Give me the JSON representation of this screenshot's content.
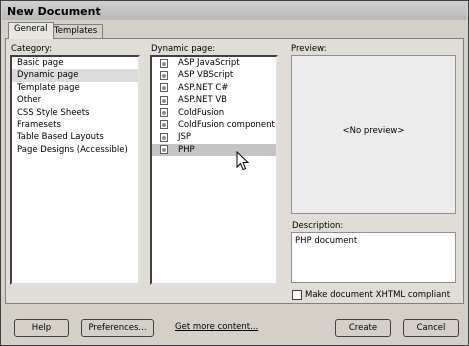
{
  "window": {
    "title": "New Document"
  },
  "tabs": [
    {
      "label": "General",
      "active": true
    },
    {
      "label": "Templates",
      "active": false
    }
  ],
  "category": {
    "label": "Category:",
    "items": [
      {
        "label": "Basic page"
      },
      {
        "label": "Dynamic page",
        "selected": true
      },
      {
        "label": "Template page"
      },
      {
        "label": "Other"
      },
      {
        "label": "CSS Style Sheets"
      },
      {
        "label": "Framesets"
      },
      {
        "label": "Table Based Layouts"
      },
      {
        "label": "Page Designs (Accessible)"
      }
    ]
  },
  "dynamic": {
    "label": "Dynamic page:",
    "items": [
      {
        "label": "ASP JavaScript"
      },
      {
        "label": "ASP VBScript"
      },
      {
        "label": "ASP.NET C#"
      },
      {
        "label": "ASP.NET VB"
      },
      {
        "label": "ColdFusion"
      },
      {
        "label": "ColdFusion component"
      },
      {
        "label": "JSP"
      },
      {
        "label": "PHP",
        "selected": true
      }
    ],
    "icon": "dynamic-document-icon"
  },
  "preview": {
    "label": "Preview:",
    "placeholder": "<No preview>"
  },
  "description": {
    "label": "Description:",
    "text": "PHP document"
  },
  "xhtml": {
    "label": "Make document XHTML compliant",
    "checked": false
  },
  "buttons": {
    "help": "Help",
    "preferences": "Preferences...",
    "more": "Get more content...",
    "create": "Create",
    "cancel": "Cancel"
  }
}
